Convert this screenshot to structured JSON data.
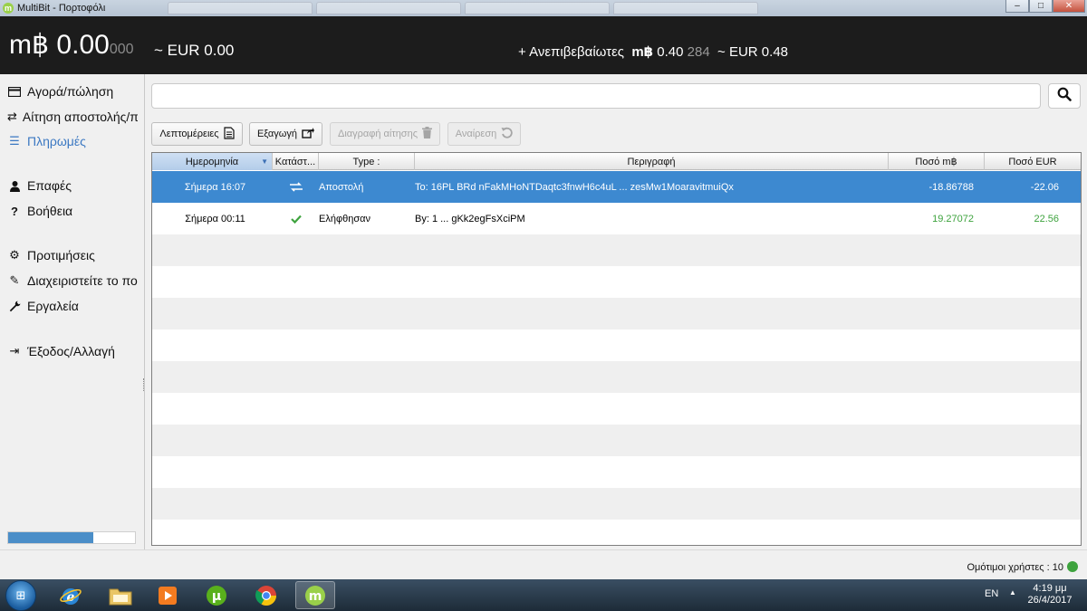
{
  "window": {
    "title": "MultiBit - Πορτοφόλι",
    "controls": {
      "minimize": "–",
      "maximize": "□",
      "close": "✕"
    }
  },
  "balance": {
    "symbol": "m฿",
    "amount": "0.00",
    "amount_dim": "000",
    "fiat": "~ EUR 0.00"
  },
  "unconfirmed": {
    "label": "+ Ανεπιβεβαίωτες",
    "symbol": "m฿",
    "amount": "0.40",
    "amount_dim": "284",
    "fiat": "~ EUR 0.48"
  },
  "sidebar": {
    "items": [
      {
        "label": "Αγορά/πώληση",
        "icon": "card-icon",
        "glyph": "▭"
      },
      {
        "label": "Αίτηση αποστολής/π",
        "icon": "exchange-icon",
        "glyph": "⇄"
      },
      {
        "label": "Πληρωμές",
        "icon": "list-icon",
        "glyph": "☰",
        "active": true
      },
      {
        "label": "Επαφές",
        "icon": "user-icon",
        "glyph": "●"
      },
      {
        "label": "Βοήθεια",
        "icon": "question-icon",
        "glyph": "?"
      },
      {
        "label": "Προτιμήσεις",
        "icon": "gears-icon",
        "glyph": "⚙"
      },
      {
        "label": "Διαχειριστείτε το πο",
        "icon": "edit-icon",
        "glyph": "✎"
      },
      {
        "label": "Εργαλεία",
        "icon": "wrench-icon",
        "glyph": "🔧"
      },
      {
        "label": "Έξοδος/Αλλαγή",
        "icon": "sign-out-icon",
        "glyph": "⇥"
      }
    ],
    "progress": 0.67
  },
  "search": {
    "placeholder": "",
    "icon": "search-icon"
  },
  "toolbar": {
    "details_label": "Λεπτομέρειες",
    "export_label": "Εξαγωγή",
    "delete_label": "Διαγραφή αίτησης",
    "undo_label": "Αναίρεση"
  },
  "table": {
    "headers": {
      "date": "Ημερομηνία",
      "status": "Κατάστ...",
      "type": "Type :",
      "description": "Περιγραφή",
      "amount": "Ποσό m฿",
      "amount_eur": "Ποσό EUR"
    },
    "rows": [
      {
        "date": "Σήμερα 16:07",
        "status_icon": "exchange-icon",
        "type": "Αποστολή",
        "description": "To:  16PL  BRd  nFakMHoNTDaqtc3fnwH6c4uL  ...  zesMw1MoaravitmuiQx",
        "amount": "-18.86788",
        "amount_eur": "-22.06"
      },
      {
        "date": "Σήμερα 00:11",
        "status_icon": "check-icon",
        "type": "Ελήφθησαν",
        "description": "By: 1  ...  gKk2egFsXciPM",
        "amount": "19.27072",
        "amount_eur": "22.56"
      }
    ]
  },
  "status": {
    "peers": "Ομότιμοι χρήστες : 10"
  },
  "taskbar": {
    "lang": "EN",
    "time": "4:19 μμ",
    "date": "26/4/2017"
  },
  "colors": {
    "accent": "#3b78c2",
    "selected_row": "#3d89d0",
    "positive": "#3ea33e",
    "header_bg": "#1c1c1c"
  }
}
